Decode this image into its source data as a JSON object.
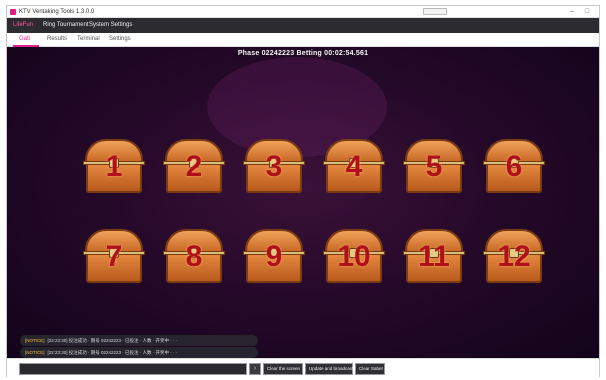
{
  "window": {
    "title": "KTV Ventaking Tools 1.3.0.0"
  },
  "menu": [
    {
      "label": "LifeFun",
      "active": true
    },
    {
      "label": "Ring Tournament",
      "active": false
    },
    {
      "label": "System Settings",
      "active": false
    }
  ],
  "tabs": [
    {
      "label": "Gati",
      "active": true
    },
    {
      "label": "Results",
      "active": false
    },
    {
      "label": "Terminal",
      "active": false
    },
    {
      "label": "Settings",
      "active": false
    }
  ],
  "game": {
    "phase_text": "Phase 02242223 Betting 00:02:54.561",
    "chests": [
      {
        "number": "1"
      },
      {
        "number": "2"
      },
      {
        "number": "3"
      },
      {
        "number": "4"
      },
      {
        "number": "5"
      },
      {
        "number": "6"
      },
      {
        "number": "7"
      },
      {
        "number": "8"
      },
      {
        "number": "9"
      },
      {
        "number": "10"
      },
      {
        "number": "11"
      },
      {
        "number": "12"
      }
    ]
  },
  "log": [
    {
      "tag": "[NOTICE]",
      "text": "[22:23:30] 投注成功 · 期号 02242223 · 已投注 · 人数 · 开奖中 · · ·"
    },
    {
      "tag": "[NOTICE]",
      "text": "[22:23:30] 投注成功 · 期号 02242223 · 已投注 · 人数 · 开奖中 · · ·"
    }
  ],
  "bottom": {
    "send_icon": "send-arrow-icon",
    "buttons": [
      {
        "label": "Clear the screen"
      },
      {
        "label": "Update and broadcast"
      },
      {
        "label": "Clear Sabet"
      }
    ]
  },
  "colors": {
    "accent": "#e0218a",
    "menubar": "#2b2b30",
    "chest_number": "#b0101a"
  }
}
